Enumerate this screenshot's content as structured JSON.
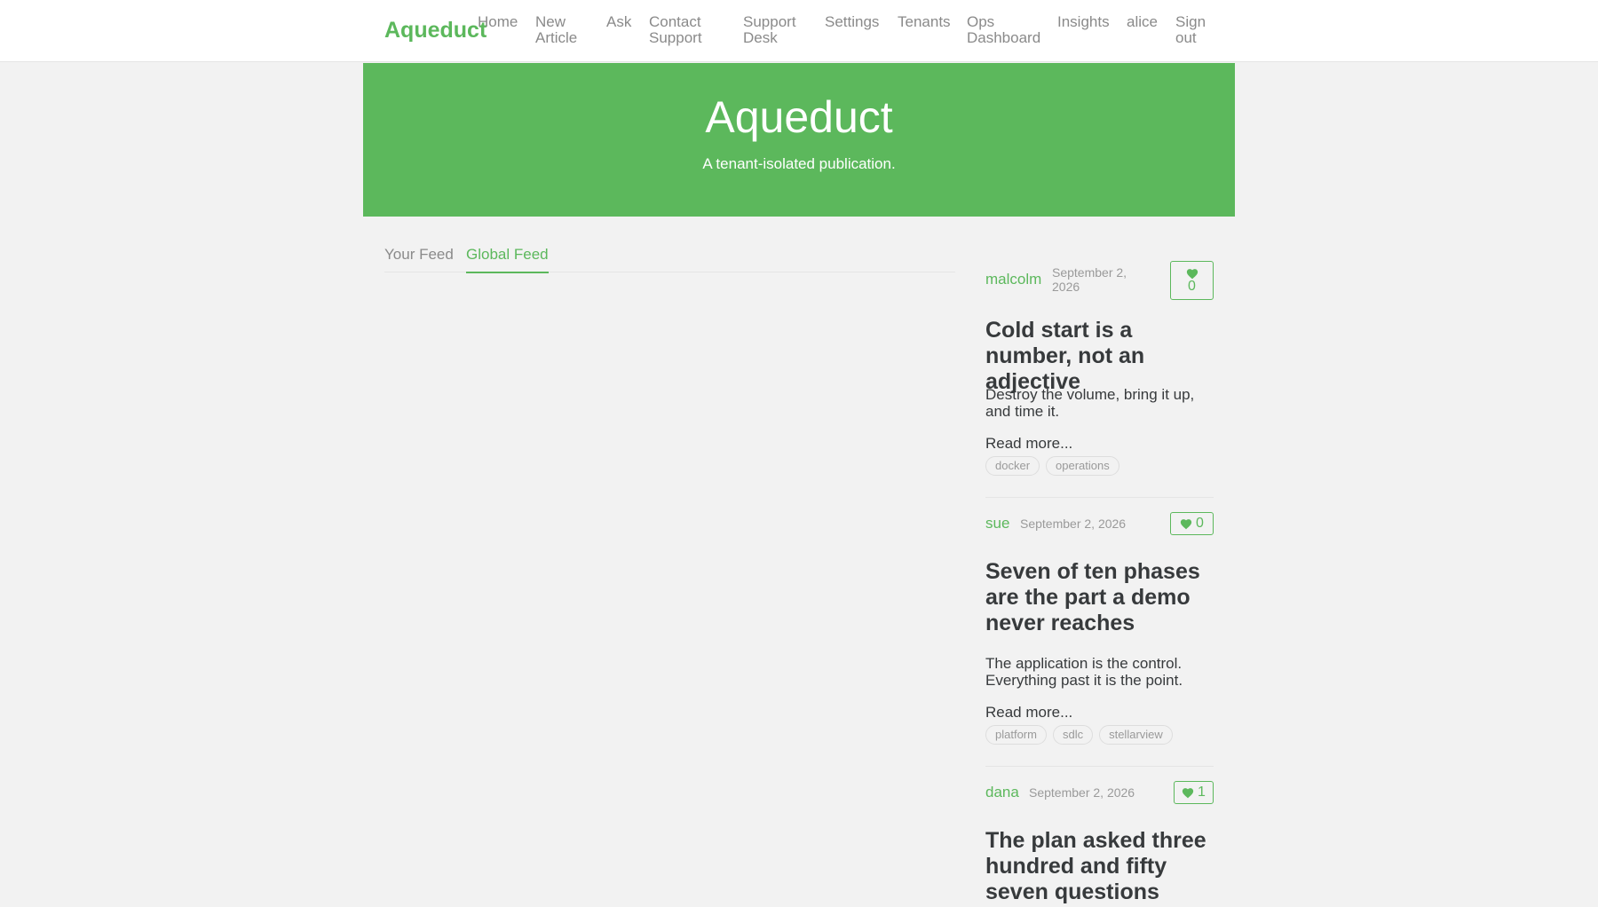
{
  "brand": "Aqueduct",
  "nav": {
    "home": "Home",
    "new_article": "New Article",
    "ask": "Ask",
    "contact_support": "Contact Support",
    "support_desk": "Support Desk",
    "settings": "Settings",
    "tenants": "Tenants",
    "ops_dashboard": "Ops Dashboard",
    "insights": "Insights",
    "user": "alice",
    "sign_out": "Sign out"
  },
  "banner": {
    "title": "Aqueduct",
    "subtitle": "A tenant-isolated publication."
  },
  "feed_tabs": {
    "your_feed": "Your Feed",
    "global_feed": "Global Feed",
    "active": "global_feed"
  },
  "articles": [
    {
      "author": "malcolm",
      "date": "September 2, 2026",
      "favorites": "0",
      "title": "Cold start is a number, not an adjective",
      "description": "Destroy the volume, bring it up, and time it.",
      "read_more": "Read more...",
      "tags": [
        "docker",
        "operations"
      ]
    },
    {
      "author": "sue",
      "date": "September 2, 2026",
      "favorites": "0",
      "title": "Seven of ten phases are the part a demo never reaches",
      "description": "The application is the control. Everything past it is the point.",
      "read_more": "Read more...",
      "tags": [
        "platform",
        "sdlc",
        "stellarview"
      ]
    },
    {
      "author": "dana",
      "date": "September 2, 2026",
      "favorites": "1",
      "title": "The plan asked three hundred and fifty seven questions"
    }
  ],
  "colors": {
    "accent": "#5cb85c",
    "background": "#f2f2f2"
  }
}
